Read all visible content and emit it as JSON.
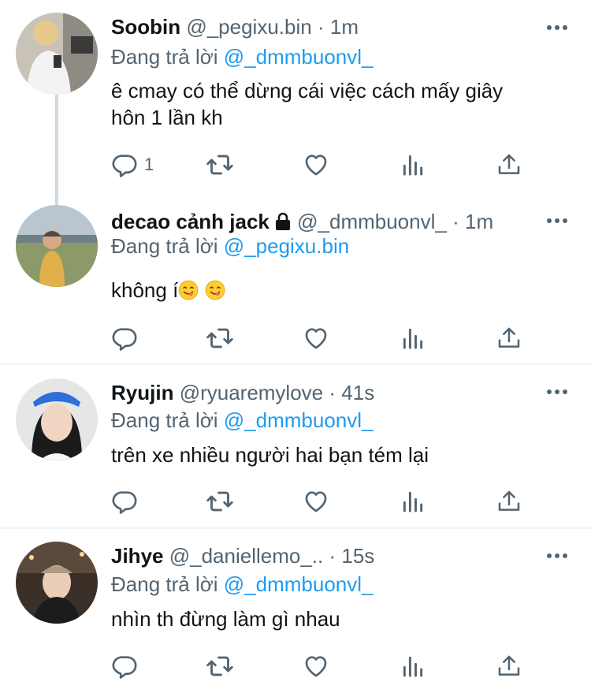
{
  "tweets": [
    {
      "name": "Soobin",
      "handle": "@_pegixu.bin",
      "dot": "·",
      "time": "1m",
      "reply_prefix": "Đang trả lời",
      "reply_to": "@_dmmbuonvl_",
      "text_line1": "ê cmay có thể dừng cái việc cách mấy giây",
      "text_line2": "hôn 1 lần kh",
      "reply_count": "1"
    },
    {
      "name": "decao cảnh jack",
      "handle": "@_dmmbuonvl_",
      "dot": "·",
      "time": "1m",
      "reply_prefix": "Đang trả lời",
      "reply_to": "@_pegixu.bin",
      "text": "không í",
      "emojis": [
        "yum-face-emoji",
        "yum-face-emoji"
      ]
    },
    {
      "name": "Ryujin",
      "handle": "@ryuaremylove",
      "dot": "·",
      "time": "41s",
      "reply_prefix": "Đang trả lời",
      "reply_to": "@_dmmbuonvl_",
      "text": "trên xe nhiều người hai bạn tém lại"
    },
    {
      "name": "Jihye",
      "handle": "@_daniellemo_..",
      "dot": "·",
      "time": "15s",
      "reply_prefix": "Đang trả lời",
      "reply_to": "@_dmmbuonvl_",
      "text": "nhìn th đừng làm gì nhau"
    }
  ],
  "colors": {
    "link": "#1d9bf0",
    "secondary": "#536471",
    "icon": "#536471",
    "thread_line": "#cfd9de",
    "divider": "#eff3f4"
  },
  "icons": [
    "reply-icon",
    "retweet-icon",
    "like-icon",
    "analytics-icon",
    "share-icon",
    "more-icon",
    "lock-icon"
  ]
}
